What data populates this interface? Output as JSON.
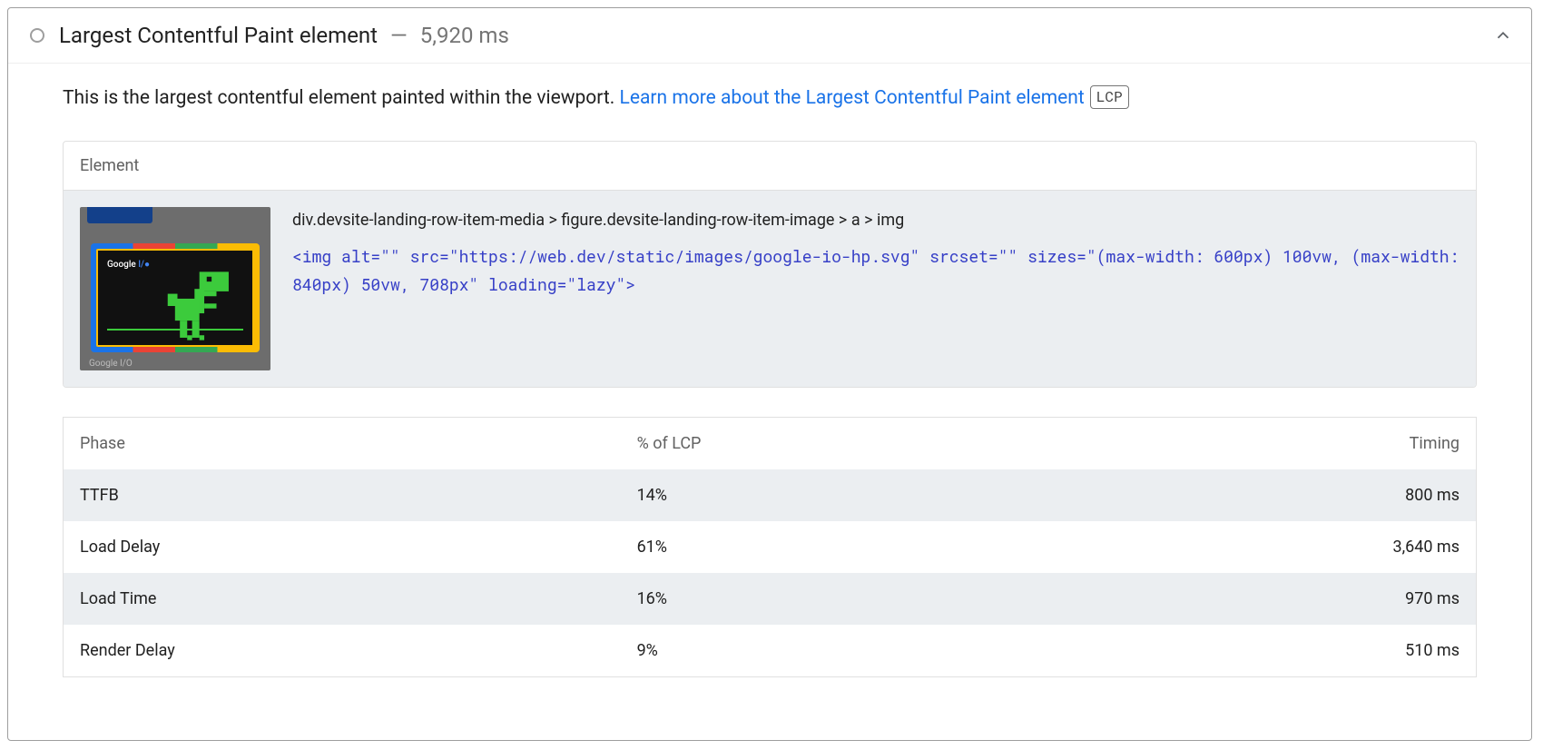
{
  "header": {
    "title": "Largest Contentful Paint element",
    "separator": "—",
    "metric": "5,920 ms"
  },
  "description": {
    "intro": "This is the largest contentful element painted within the viewport. ",
    "link_text": "Learn more about the Largest Contentful Paint element",
    "badge": "LCP"
  },
  "element_card": {
    "heading": "Element",
    "thumb_label": "Google I/O",
    "thumb_label_prefix": "Google ",
    "thumb_label_suffix": "I/●",
    "selector": "div.devsite-landing-row-item-media > figure.devsite-landing-row-item-image > a > img",
    "markup": "<img alt=\"\" src=\"https://web.dev/static/images/google-io-hp.svg\" srcset=\"\" sizes=\"(max-width: 600px) 100vw, (max-width: 840px) 50vw, 708px\" loading=\"lazy\">"
  },
  "table": {
    "columns": [
      "Phase",
      "% of LCP",
      "Timing"
    ],
    "rows": [
      {
        "phase": "TTFB",
        "pct": "14%",
        "timing": "800 ms"
      },
      {
        "phase": "Load Delay",
        "pct": "61%",
        "timing": "3,640 ms"
      },
      {
        "phase": "Load Time",
        "pct": "16%",
        "timing": "970 ms"
      },
      {
        "phase": "Render Delay",
        "pct": "9%",
        "timing": "510 ms"
      }
    ]
  }
}
